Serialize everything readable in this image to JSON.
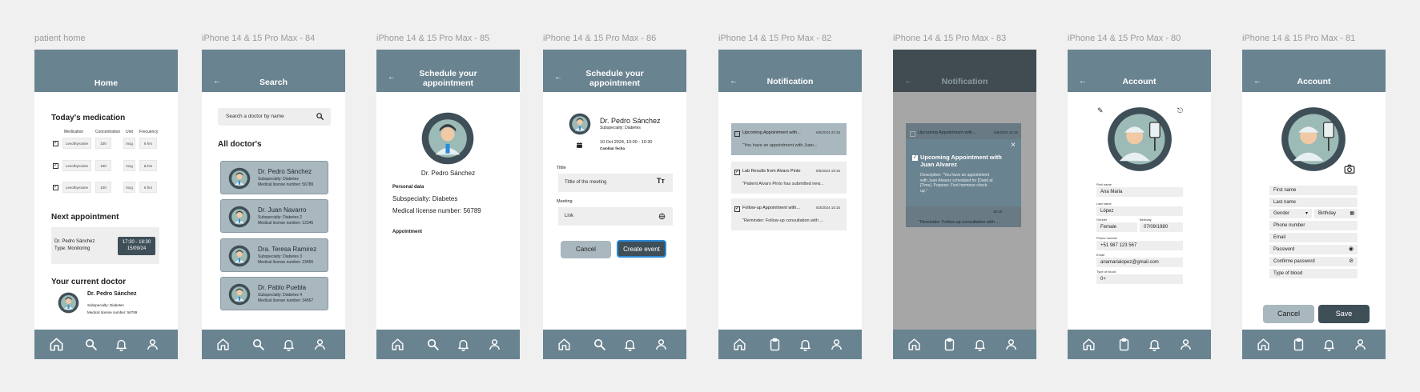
{
  "frames": {
    "home": "patient home",
    "search": "iPhone 14 & 15 Pro Max - 84",
    "profile": "iPhone 14 & 15 Pro Max - 85",
    "schedule": "iPhone 14 & 15 Pro Max - 86",
    "notifications": "iPhone 14 & 15 Pro Max - 82",
    "notif_detail": "iPhone 14 & 15 Pro Max - 83",
    "account": "iPhone 14 & 15 Pro Max - 80",
    "account_edit": "iPhone 14 & 15 Pro Max - 81"
  },
  "colors": {
    "header": "#6a8390",
    "card": "#a9b7bf",
    "dark": "#3f4f58",
    "accent": "#2a8ad8"
  },
  "home": {
    "title": "Home",
    "med_title": "Today's medication",
    "headers": [
      "Medication",
      "Concentration",
      "Unit",
      "Frecuency"
    ],
    "meds": [
      [
        "Levothyroxine",
        "100",
        "mcg",
        "6 hrs"
      ],
      [
        "Levothyroxine",
        "100",
        "mcg",
        "& hrs"
      ],
      [
        "Levothyroxine",
        "100",
        "mcg",
        "6 hrs"
      ]
    ],
    "next_title": "Next appointment",
    "appt_doctor": "Dr. Pedro Sánchez",
    "appt_type": "Type: Monitoring",
    "appt_time": "17:30 - 18:30",
    "appt_date": "15/09/24",
    "doctor_title": "Your current doctor",
    "doctor_name": "Dr. Pedro Sánchez",
    "doctor_sub": "Subspecialty: Diabetes",
    "doctor_license": "Medical license number: 56789"
  },
  "search": {
    "title": "Search",
    "placeholder": "Search a doctor by name",
    "all": "All doctor's",
    "doctors": [
      {
        "name": "Dr. Pedro Sánchez",
        "sub": "Subspecialty: Diabetes",
        "lic": "Medical license number: 56789"
      },
      {
        "name": "Dr. Juan Navarro",
        "sub": "Subspecialty: Diabetes 2",
        "lic": "Medical license number: 12345"
      },
      {
        "name": "Dra. Teresa Ramirez",
        "sub": "Subspecialty: Diabetes 3",
        "lic": "Medical license number: 23456"
      },
      {
        "name": "Dr. Pablo Puebla",
        "sub": "Subspecialty: Diabetes 4",
        "lic": "Medical license number: 34567"
      }
    ]
  },
  "profile": {
    "title1": "Schedule your",
    "title2": "appointment",
    "name": "Dr. Pedro Sánchez",
    "personal": "Personal data",
    "sub": "Subspecialty: Diabetes",
    "lic": "Medical license number: 56789",
    "appointment": "Appointment"
  },
  "schedule": {
    "title1": "Schedule your",
    "title2": "appointment",
    "name": "Dr. Pedro Sánchez",
    "sub": "Subspecialty: Diabetes",
    "datetime": "10 Oct 2024, 10:00 - 10:30",
    "change": "Cambiar fecha",
    "title_label": "Tittle",
    "title_placeholder": "Tittle of the meeting",
    "meeting_label": "Meeting",
    "link_placeholder": "Link",
    "cancel": "Cancel",
    "create": "Create event"
  },
  "notifications": {
    "title": "Notification",
    "items": [
      {
        "title": "Upcoming Appointment with...",
        "date": "6/6/2024 22:15",
        "text": "\"You have an appointment with Juan..."
      },
      {
        "title": "Lab Results from Alvaro Pinto",
        "date": "6/5/2024 19:15",
        "text": "\"Patient Alvaro Pinto has submitted new..."
      },
      {
        "title": "Follow-up Appointment with...",
        "date": "5/3/2024 15:15",
        "text": "\"Reminder: Follow-up consultation with ..."
      }
    ]
  },
  "notif_detail": {
    "title": "Notification",
    "top_title": "Upcoming Appointment with...",
    "top_date": "6/6/2024 22:15",
    "popup_title1": "Upcoming Appointment with",
    "popup_title2": "Juan Alvarez",
    "popup_desc": [
      "Description: \"You have an appointment",
      "with Juan Alvarez scheduled for [Date] at",
      "[Time]. Purpose: First hormone check-",
      "up.\""
    ],
    "hidden_time": "15:15",
    "bottom_text": "\"Reminder: Follow-up consultation with ...",
    "close": "×"
  },
  "account": {
    "title": "Account",
    "fields": [
      {
        "label": "First name",
        "value": "Ana Maria"
      },
      {
        "label": "Last name",
        "value": "López"
      },
      {
        "label": "Gender",
        "value": "Female"
      },
      {
        "label": "Birthday",
        "value": "07/09/1980"
      },
      {
        "label": "Phone number",
        "value": "+51 987 123 567"
      },
      {
        "label": "Email",
        "value": "anamarialopez@gmail.com"
      },
      {
        "label": "Type of blood",
        "value": "0+"
      }
    ]
  },
  "account_edit": {
    "title": "Account",
    "first": "First name",
    "last": "Last name",
    "gender": "Gender",
    "birthday": "Birthday",
    "phone": "Phone number",
    "email": "Email",
    "password": "Password",
    "confirm": "Confirme password",
    "blood": "Type of blood",
    "cancel": "Cancel",
    "save": "Save"
  }
}
